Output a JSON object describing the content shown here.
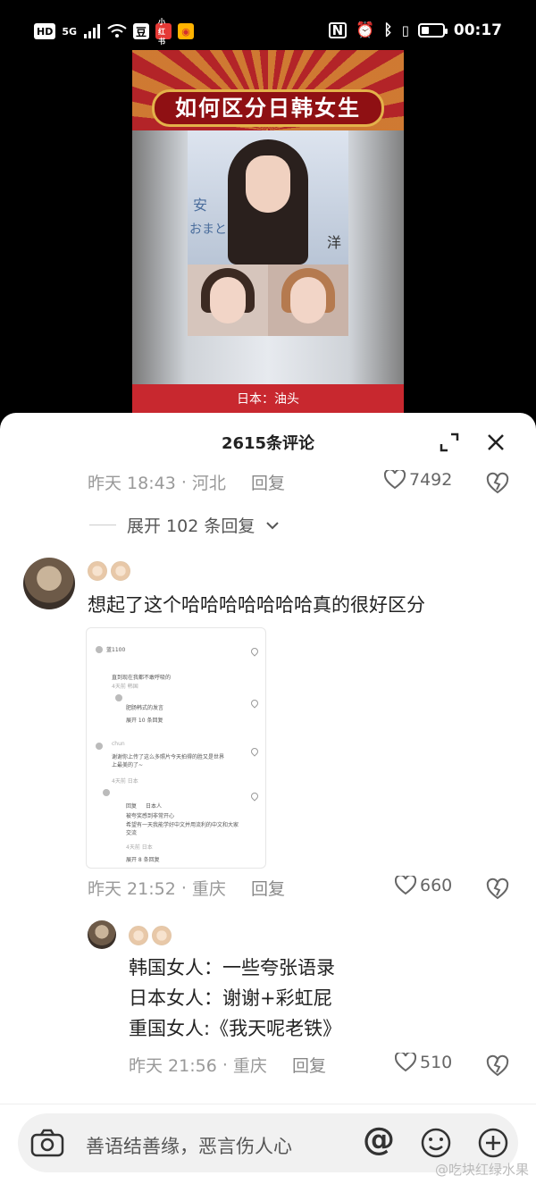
{
  "status_bar": {
    "hd": "HD",
    "network": "5G",
    "signal_sub": "46",
    "wifi_sub": "6",
    "app_douban": "豆",
    "app_red": "小红书",
    "app_weibo": "微博",
    "time": "00:17",
    "battery_level": 0.3
  },
  "video": {
    "banner_title": "如何区分日韩女生",
    "caption": "日本：油头",
    "sign_text_left": "安",
    "sign_text_left2": "おまと",
    "sign_text_right": "洋"
  },
  "comments_panel": {
    "title": "2615条评论",
    "expand_icon": "expand-icon",
    "close_icon": "close-icon"
  },
  "comment_prev": {
    "time": "昨天 18:43",
    "location": "河北",
    "reply_label": "回复",
    "likes": "7492"
  },
  "expand_replies_label": "展开 102 条回复",
  "comment_main": {
    "text": "想起了这个哈哈哈哈哈哈哈真的很好区分",
    "time": "昨天 21:52",
    "location": "重庆",
    "reply_label": "回复",
    "likes": "660",
    "thumb_texts": [
      "蓝1100",
      "直到现在我都不敢呼吸的",
      "4天前 韩国",
      "肥肠韩式的发言",
      "展开 10 条回复",
      "chun",
      "谢谢你上传了这么多照片今天拍得的胜又是世界上最美的了~",
      "4天前 日本",
      "回复",
      "日本人",
      "被夸奖感到非常开心",
      "希望有一天我能学好中文并用流利的中文和大家交流",
      "4天前 日本",
      "展开 8 条回复"
    ]
  },
  "reply": {
    "lines": [
      "韩国女人：一些夸张语录",
      "日本女人：谢谢+彩虹屁",
      "重国女人:《我天呢老铁》"
    ],
    "time": "昨天 21:56",
    "location": "重庆",
    "reply_label": "回复",
    "likes": "510"
  },
  "input": {
    "placeholder": "善语结善缘，恶言伤人心",
    "icons": [
      "camera-icon",
      "at-icon",
      "emoji-icon",
      "plus-icon"
    ]
  },
  "watermark": "@吃块红绿水果"
}
